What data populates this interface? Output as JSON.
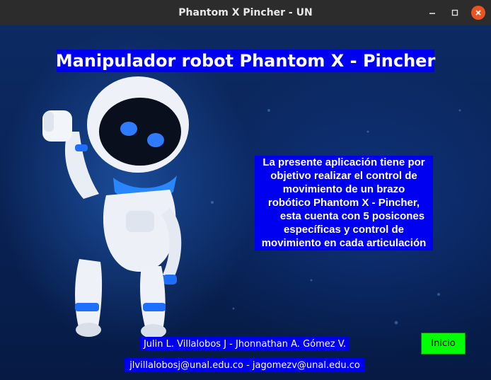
{
  "window": {
    "title": "Phantom X  Pincher - UN",
    "controls": {
      "minimize": "minimize-icon",
      "maximize": "maximize-icon",
      "close": "close-icon"
    }
  },
  "main": {
    "title": "Manipulador robot Phantom X - Pincher",
    "description_lines": [
      "La presente aplicación tiene por",
      "objetivo realizar el control de",
      "movimiento de un brazo",
      "robótico Phantom X - Pincher,",
      "esta cuenta con 5 posicones",
      "específicas y control de",
      "movimiento en cada articulación"
    ],
    "authors": "Julin L. Villalobos J - Jhonnathan A. Gómez V.",
    "emails": "jlvillalobosj@unal.edu.co - jagomezv@unal.edu.co",
    "start_button": "Inicio",
    "background_image": "robot-illustration"
  },
  "colors": {
    "label_bg": "#0000f0",
    "button_bg": "#00ff00",
    "titlebar_bg": "#2c2c2c",
    "close_btn": "#e95420"
  }
}
